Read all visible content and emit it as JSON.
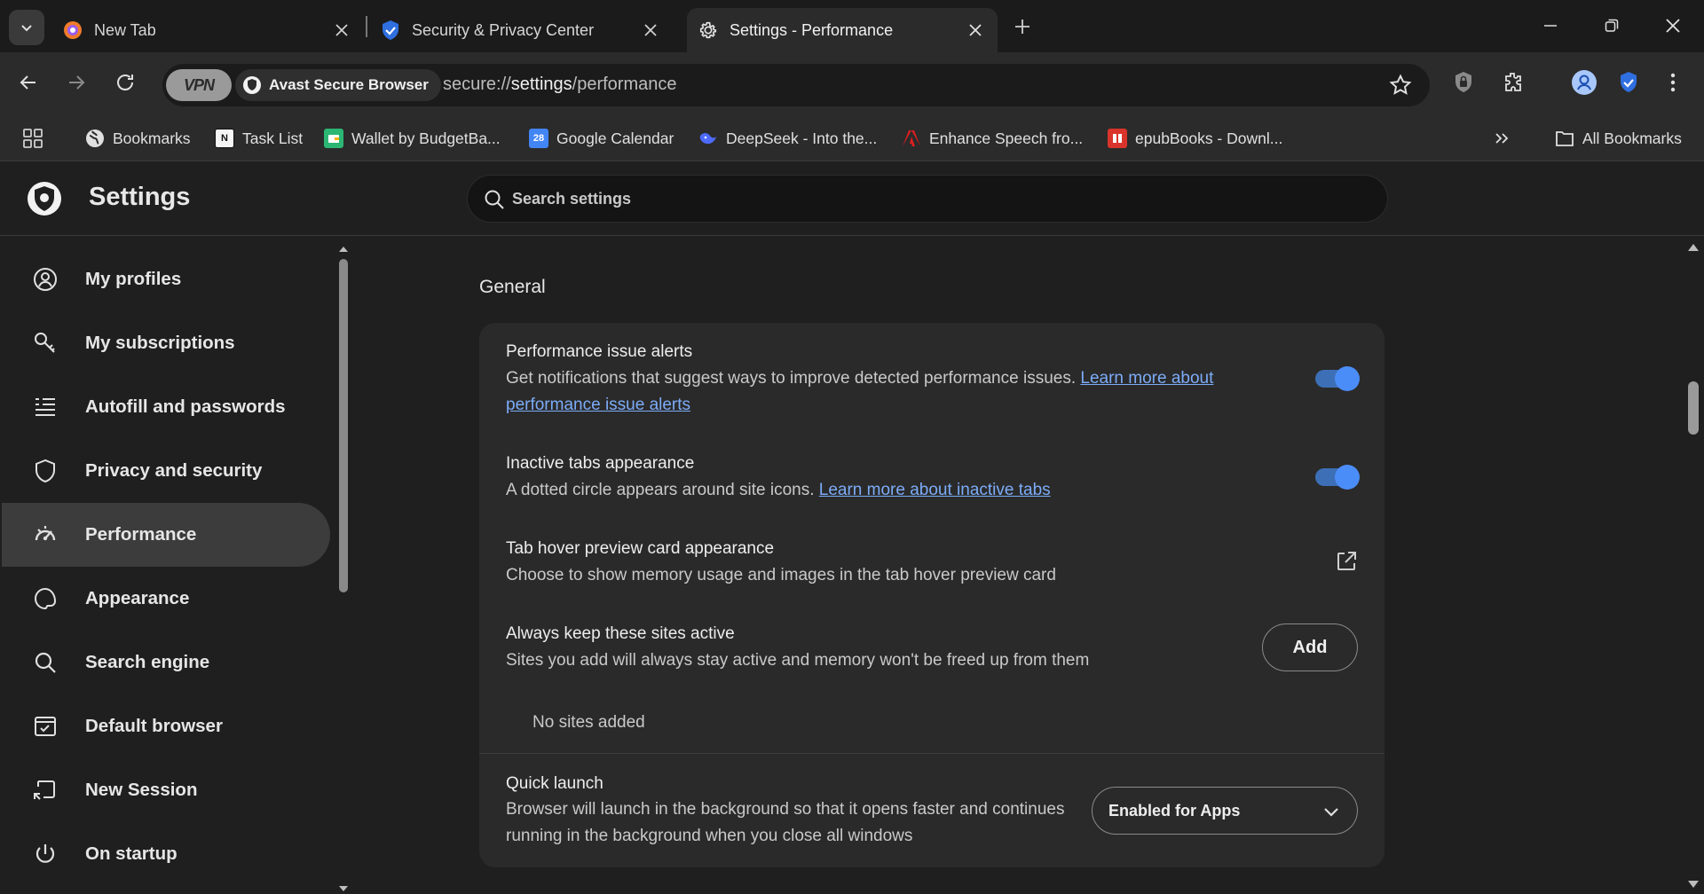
{
  "tabs": [
    {
      "title": "New Tab",
      "icon": "browser-logo-icon"
    },
    {
      "title": "Security & Privacy Center",
      "icon": "shield-check-icon"
    },
    {
      "title": "Settings - Performance",
      "icon": "gear-icon",
      "active": true
    }
  ],
  "omnibox": {
    "vpn_label": "VPN",
    "brand_label": "Avast Secure Browser",
    "url_scheme": "secure://",
    "url_host": "settings",
    "url_path": "/performance"
  },
  "bookmarks": [
    {
      "label": "Bookmarks",
      "icon": "globe-icon",
      "color": "#5a5a5a"
    },
    {
      "label": "Task List",
      "icon": "notion-icon",
      "color": "#ffffff"
    },
    {
      "label": "Wallet by BudgetBa...",
      "icon": "wallet-icon",
      "color": "#2bb673"
    },
    {
      "label": "Google Calendar",
      "icon": "calendar-icon",
      "color": "#4285f4"
    },
    {
      "label": "DeepSeek - Into the...",
      "icon": "deepseek-icon",
      "color": "#4d6bfe"
    },
    {
      "label": "Enhance Speech fro...",
      "icon": "adobe-icon",
      "color": "#e01e1e"
    },
    {
      "label": "epubBooks - Downl...",
      "icon": "epubbooks-icon",
      "color": "#d9342b"
    }
  ],
  "all_bookmarks_label": "All Bookmarks",
  "settings": {
    "title": "Settings",
    "search_placeholder": "Search settings"
  },
  "sidebar": [
    {
      "label": "My profiles",
      "icon": "profile-icon"
    },
    {
      "label": "My subscriptions",
      "icon": "key-icon"
    },
    {
      "label": "Autofill and passwords",
      "icon": "list-icon"
    },
    {
      "label": "Privacy and security",
      "icon": "shield-icon"
    },
    {
      "label": "Performance",
      "icon": "speedometer-icon",
      "active": true
    },
    {
      "label": "Appearance",
      "icon": "palette-icon"
    },
    {
      "label": "Search engine",
      "icon": "search-icon"
    },
    {
      "label": "Default browser",
      "icon": "browser-window-icon"
    },
    {
      "label": "New Session",
      "icon": "new-session-icon"
    },
    {
      "label": "On startup",
      "icon": "power-icon"
    }
  ],
  "general": {
    "section_title": "General",
    "perf_alerts": {
      "title": "Performance issue alerts",
      "desc": "Get notifications that suggest ways to improve detected performance issues.",
      "link": "Learn more about performance issue alerts",
      "enabled": true
    },
    "inactive_tabs": {
      "title": "Inactive tabs appearance",
      "desc": "A dotted circle appears around site icons.",
      "link": "Learn more about inactive tabs",
      "enabled": true
    },
    "hover_card": {
      "title": "Tab hover preview card appearance",
      "desc": "Choose to show memory usage and images in the tab hover preview card"
    },
    "keep_active": {
      "title": "Always keep these sites active",
      "desc": "Sites you add will always stay active and memory won't be freed up from them",
      "button": "Add",
      "empty": "No sites added"
    },
    "quick_launch": {
      "title": "Quick launch",
      "desc_line1": "Browser will launch in the background so that it opens faster and continues",
      "desc_line2": "running in the background when you close all windows",
      "value": "Enabled for Apps"
    }
  },
  "colors": {
    "accent": "#4b8df8",
    "link": "#7cacf8",
    "background": "#1f1f1f",
    "card": "#2a2a2a"
  }
}
